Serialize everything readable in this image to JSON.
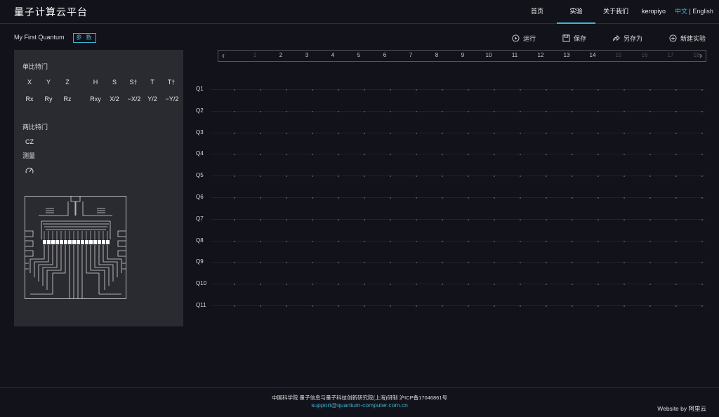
{
  "app": {
    "title": "量子计算云平台"
  },
  "nav": {
    "items": [
      "首页",
      "实验",
      "关于我们"
    ],
    "active": "实验",
    "user": "keropiyo",
    "lang_zh": "中文",
    "lang_sep": " | ",
    "lang_en": "English"
  },
  "project": {
    "name": "My First Quantum",
    "param_label": "参 数"
  },
  "toolbar": {
    "run": "运行",
    "save": "保存",
    "save_as": "另存为",
    "new": "新建实验"
  },
  "gates": {
    "single_title": "单比特门",
    "row1": [
      "X",
      "Y",
      "Z",
      "H",
      "S",
      "S†",
      "T",
      "T†"
    ],
    "row2": [
      "Rx",
      "Ry",
      "Rz",
      "Rxy",
      "X/2",
      "−X/2",
      "Y/2",
      "−Y/2"
    ],
    "two_title": "两比特门",
    "two": [
      "CZ"
    ],
    "measure_title": "测量"
  },
  "ruler": {
    "columns": [
      "1",
      "2",
      "3",
      "4",
      "5",
      "6",
      "7",
      "8",
      "9",
      "10",
      "11",
      "12",
      "13",
      "14",
      "15",
      "16",
      "17",
      "18"
    ],
    "enabled_through": 14
  },
  "qubits": [
    "Q1",
    "Q2",
    "Q3",
    "Q4",
    "Q5",
    "Q6",
    "Q7",
    "Q8",
    "Q9",
    "Q10",
    "Q11"
  ],
  "footer": {
    "copyright": "中国科学院 量子信息与量子科技创新研究院(上海)研制 沪ICP备17046861号",
    "email": "support@quantum-computer.com.cn",
    "website": "Website by 阿里云"
  },
  "colors": {
    "accent": "#3fb6d1",
    "background": "#11121a",
    "panel": "#2a2b31"
  }
}
